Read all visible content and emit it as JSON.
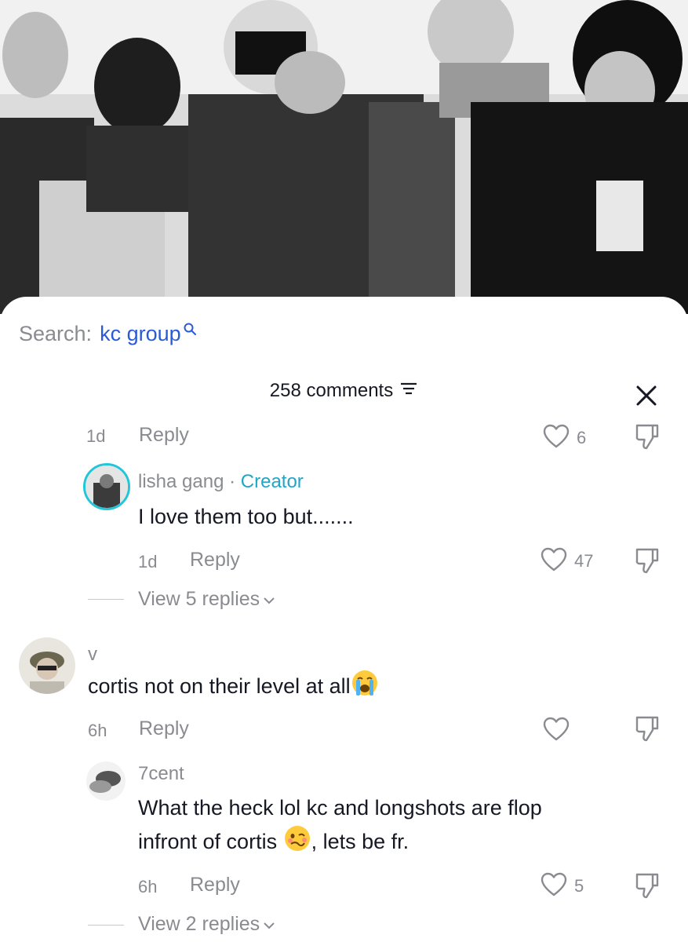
{
  "search": {
    "label": "Search:",
    "query": "kc group"
  },
  "header": {
    "count_label": "258 comments"
  },
  "comments": [
    {
      "time": "1d",
      "reply": "Reply",
      "likes": "6"
    },
    {
      "name": "lisha gang",
      "separator": "·",
      "badge": "Creator",
      "text": "I love them too but.......",
      "time": "1d",
      "reply": "Reply",
      "likes": "47",
      "view_replies": "View 5 replies"
    },
    {
      "name": "v",
      "text": "cortis not on their level at all",
      "emoji": "loudly-crying-face",
      "time": "6h",
      "reply": "Reply",
      "likes": ""
    },
    {
      "name": "7cent",
      "text_line1": "What the heck lol kc and longshots are flop",
      "text_line2_a": "infront of cortis",
      "emoji": "woozy-face",
      "text_line2_b": ", lets be fr.",
      "time": "6h",
      "reply": "Reply",
      "likes": "5",
      "view_replies": "View 2 replies"
    }
  ],
  "colors": {
    "link_blue": "#2a5bd7",
    "creator_teal": "#21a6c8",
    "muted": "#8a8b91"
  }
}
